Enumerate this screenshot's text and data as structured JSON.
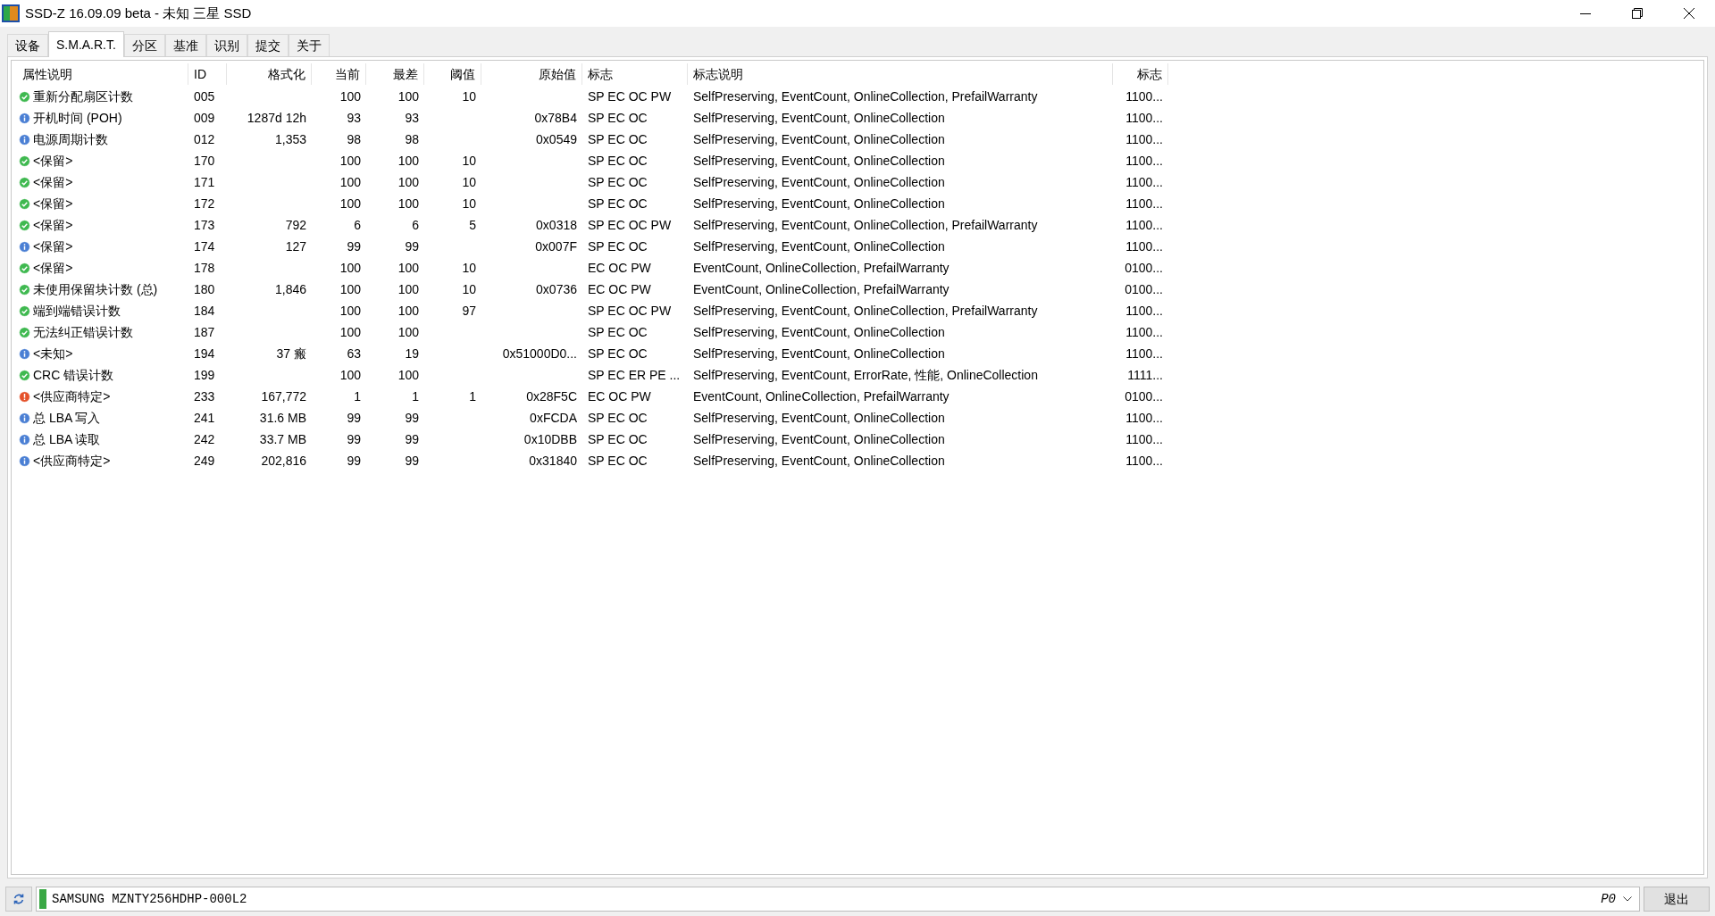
{
  "window": {
    "title": "SSD-Z 16.09.09 beta - 未知 三星 SSD"
  },
  "tabs": [
    {
      "label": "设备",
      "selected": false
    },
    {
      "label": "S.M.A.R.T.",
      "selected": true
    },
    {
      "label": "分区",
      "selected": false
    },
    {
      "label": "基准",
      "selected": false
    },
    {
      "label": "识别",
      "selected": false
    },
    {
      "label": "提交",
      "selected": false
    },
    {
      "label": "关于",
      "selected": false
    }
  ],
  "table": {
    "columns": [
      "属性说明",
      "ID",
      "格式化",
      "当前",
      "最差",
      "阈值",
      "原始值",
      "标志",
      "标志说明",
      "标志"
    ],
    "rows": [
      {
        "kind": "ok",
        "cells": [
          "重新分配扇区计数",
          "005",
          "",
          "100",
          "100",
          "10",
          "",
          "SP EC OC PW",
          "SelfPreserving, EventCount, OnlineCollection, PrefailWarranty",
          "1100..."
        ]
      },
      {
        "kind": "info",
        "cells": [
          "开机时间 (POH)",
          "009",
          "1287d 12h",
          "93",
          "93",
          "",
          "0x78B4",
          "SP EC OC",
          "SelfPreserving, EventCount, OnlineCollection",
          "1100..."
        ]
      },
      {
        "kind": "info",
        "cells": [
          "电源周期计数",
          "012",
          "1,353",
          "98",
          "98",
          "",
          "0x0549",
          "SP EC OC",
          "SelfPreserving, EventCount, OnlineCollection",
          "1100..."
        ]
      },
      {
        "kind": "ok",
        "cells": [
          "<保留>",
          "170",
          "",
          "100",
          "100",
          "10",
          "",
          "SP EC OC",
          "SelfPreserving, EventCount, OnlineCollection",
          "1100..."
        ]
      },
      {
        "kind": "ok",
        "cells": [
          "<保留>",
          "171",
          "",
          "100",
          "100",
          "10",
          "",
          "SP EC OC",
          "SelfPreserving, EventCount, OnlineCollection",
          "1100..."
        ]
      },
      {
        "kind": "ok",
        "cells": [
          "<保留>",
          "172",
          "",
          "100",
          "100",
          "10",
          "",
          "SP EC OC",
          "SelfPreserving, EventCount, OnlineCollection",
          "1100..."
        ]
      },
      {
        "kind": "ok",
        "cells": [
          "<保留>",
          "173",
          "792",
          "6",
          "6",
          "5",
          "0x0318",
          "SP EC OC PW",
          "SelfPreserving, EventCount, OnlineCollection, PrefailWarranty",
          "1100..."
        ]
      },
      {
        "kind": "info",
        "cells": [
          "<保留>",
          "174",
          "127",
          "99",
          "99",
          "",
          "0x007F",
          "SP EC OC",
          "SelfPreserving, EventCount, OnlineCollection",
          "1100..."
        ]
      },
      {
        "kind": "ok",
        "cells": [
          "<保留>",
          "178",
          "",
          "100",
          "100",
          "10",
          "",
          "EC OC PW",
          "EventCount, OnlineCollection, PrefailWarranty",
          "0100..."
        ]
      },
      {
        "kind": "ok",
        "cells": [
          "未使用保留块计数 (总)",
          "180",
          "1,846",
          "100",
          "100",
          "10",
          "0x0736",
          "EC OC PW",
          "EventCount, OnlineCollection, PrefailWarranty",
          "0100..."
        ]
      },
      {
        "kind": "ok",
        "cells": [
          "端到端错误计数",
          "184",
          "",
          "100",
          "100",
          "97",
          "",
          "SP EC OC PW",
          "SelfPreserving, EventCount, OnlineCollection, PrefailWarranty",
          "1100..."
        ]
      },
      {
        "kind": "ok",
        "cells": [
          "无法纠正错误计数",
          "187",
          "",
          "100",
          "100",
          "",
          "",
          "SP EC OC",
          "SelfPreserving, EventCount, OnlineCollection",
          "1100..."
        ]
      },
      {
        "kind": "info",
        "cells": [
          "<未知>",
          "194",
          "37 瘢",
          "63",
          "19",
          "",
          "0x51000D0...",
          "SP EC OC",
          "SelfPreserving, EventCount, OnlineCollection",
          "1100..."
        ]
      },
      {
        "kind": "ok",
        "cells": [
          "CRC 错误计数",
          "199",
          "",
          "100",
          "100",
          "",
          "",
          "SP EC ER PE ...",
          "SelfPreserving, EventCount, ErrorRate, 性能, OnlineCollection",
          "1111..."
        ]
      },
      {
        "kind": "warn",
        "cells": [
          "<供应商特定>",
          "233",
          "167,772",
          "1",
          "1",
          "1",
          "0x28F5C",
          "EC OC PW",
          "EventCount, OnlineCollection, PrefailWarranty",
          "0100..."
        ]
      },
      {
        "kind": "info",
        "cells": [
          "总 LBA 写入",
          "241",
          "31.6 MB",
          "99",
          "99",
          "",
          "0xFCDA",
          "SP EC OC",
          "SelfPreserving, EventCount, OnlineCollection",
          "1100..."
        ]
      },
      {
        "kind": "info",
        "cells": [
          "总 LBA 读取",
          "242",
          "33.7 MB",
          "99",
          "99",
          "",
          "0x10DBB",
          "SP EC OC",
          "SelfPreserving, EventCount, OnlineCollection",
          "1100..."
        ]
      },
      {
        "kind": "info",
        "cells": [
          "<供应商特定>",
          "249",
          "202,816",
          "99",
          "99",
          "",
          "0x31840",
          "SP EC OC",
          "SelfPreserving, EventCount, OnlineCollection",
          "1100..."
        ]
      }
    ]
  },
  "bottom": {
    "drive": "SAMSUNG MZNTY256HDHP-000L2",
    "partition": "P0",
    "exit": "退出"
  }
}
